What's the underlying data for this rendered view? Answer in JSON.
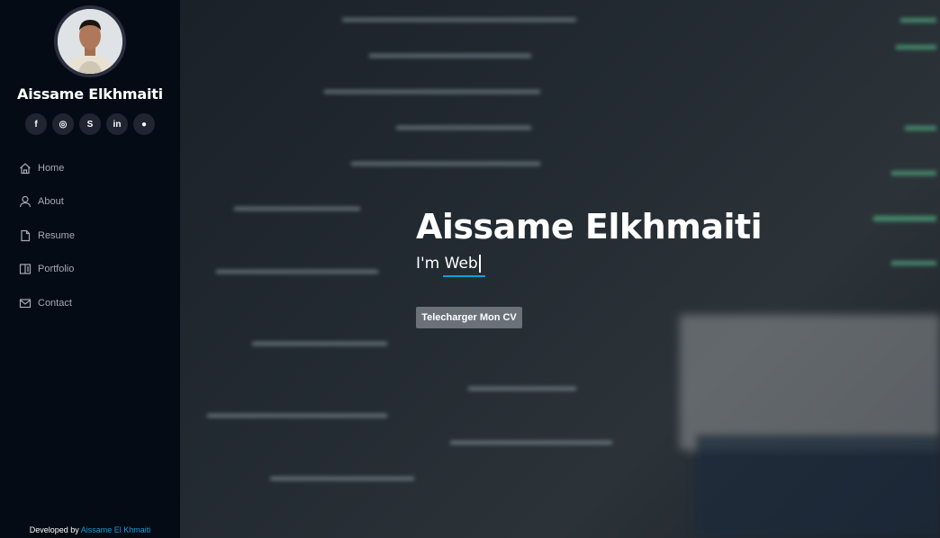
{
  "sidebar": {
    "name": "Aissame Elkhmaiti",
    "social": [
      {
        "icon": "facebook-icon",
        "glyph": "f"
      },
      {
        "icon": "instagram-icon",
        "glyph": "◎"
      },
      {
        "icon": "skype-icon",
        "glyph": "S"
      },
      {
        "icon": "linkedin-icon",
        "glyph": "in"
      },
      {
        "icon": "github-icon",
        "glyph": "●"
      }
    ],
    "nav": [
      {
        "label": "Home",
        "icon": "home-icon"
      },
      {
        "label": "About",
        "icon": "user-icon"
      },
      {
        "label": "Resume",
        "icon": "file-icon"
      },
      {
        "label": "Portfolio",
        "icon": "book-icon"
      },
      {
        "label": "Contact",
        "icon": "envelope-icon"
      }
    ],
    "footer": {
      "prefix": "Developed by",
      "link": "Aissame El Khmaiti"
    }
  },
  "hero": {
    "title": "Aissame Elkhmaiti",
    "subtitle_prefix": "I'm",
    "typed": "Web",
    "button": "Telecharger Mon CV"
  },
  "colors": {
    "accent": "#149ddd",
    "sidebar_bg": "#040b14"
  }
}
